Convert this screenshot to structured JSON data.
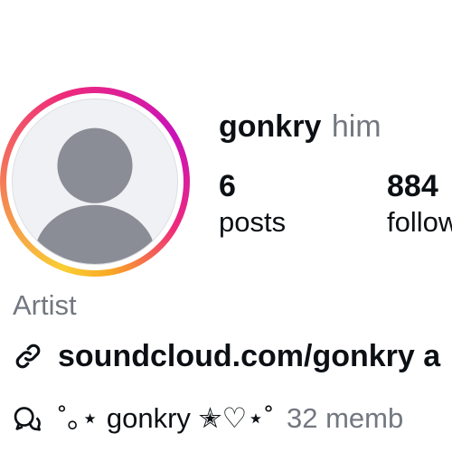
{
  "profile": {
    "username": "gonkry",
    "pronouns": "him",
    "category": "Artist",
    "link": "soundcloud.com/gonkry a",
    "avatar_icon": "default-avatar-icon"
  },
  "stats": {
    "posts_value": "6",
    "posts_label": "posts",
    "followers_value": "884",
    "followers_label": "follow"
  },
  "channel": {
    "icon": "threads-icon",
    "name": "˚｡⋆ gonkry ✭♡⋆˚",
    "members": "32 memb"
  },
  "colors": {
    "ring_yellow": "#f9ce34",
    "ring_pink": "#ee2a7b",
    "ring_purple": "#c913b9",
    "avatar_bg": "#eff1f4",
    "avatar_fg": "#8b8d96",
    "secondary_text": "#737780"
  }
}
